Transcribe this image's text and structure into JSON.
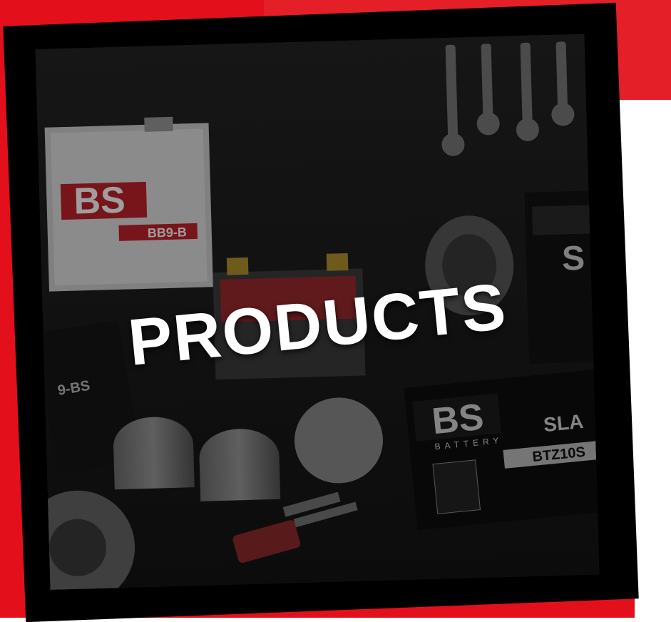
{
  "card": {
    "title": "PRODUCTS"
  },
  "photo": {
    "battery_brand": "BS",
    "battery_subbrand": "BATTERY",
    "battery_type": "SLA",
    "battery_model": "BTZ10S",
    "battery_model_2": "BB9-B",
    "battery_model_3": "9-BS"
  },
  "colors": {
    "brand_red": "#e3101c",
    "card_black": "#000000",
    "title_white": "#ffffff"
  }
}
